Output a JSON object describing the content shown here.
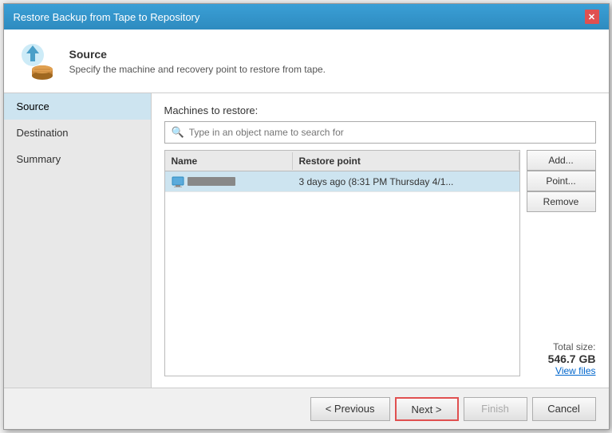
{
  "titleBar": {
    "title": "Restore Backup from Tape to Repository",
    "closeLabel": "✕"
  },
  "header": {
    "title": "Source",
    "description": "Specify the machine and recovery point to restore from tape."
  },
  "sidebar": {
    "items": [
      {
        "id": "source",
        "label": "Source",
        "active": true
      },
      {
        "id": "destination",
        "label": "Destination",
        "active": false
      },
      {
        "id": "summary",
        "label": "Summary",
        "active": false
      }
    ]
  },
  "main": {
    "machinesLabel": "Machines to restore:",
    "searchPlaceholder": "Type in an object name to search for",
    "table": {
      "columns": [
        {
          "id": "name",
          "label": "Name"
        },
        {
          "id": "restorePoint",
          "label": "Restore point"
        }
      ],
      "rows": [
        {
          "name": "████████",
          "restorePoint": "3 days ago (8:31 PM Thursday 4/1...",
          "selected": true
        }
      ]
    },
    "buttons": {
      "add": "Add...",
      "point": "Point...",
      "remove": "Remove"
    },
    "totalSize": {
      "label": "Total size:",
      "value": "546.7 GB"
    },
    "viewFiles": "View files"
  },
  "footer": {
    "previous": "< Previous",
    "next": "Next >",
    "finish": "Finish",
    "cancel": "Cancel"
  }
}
